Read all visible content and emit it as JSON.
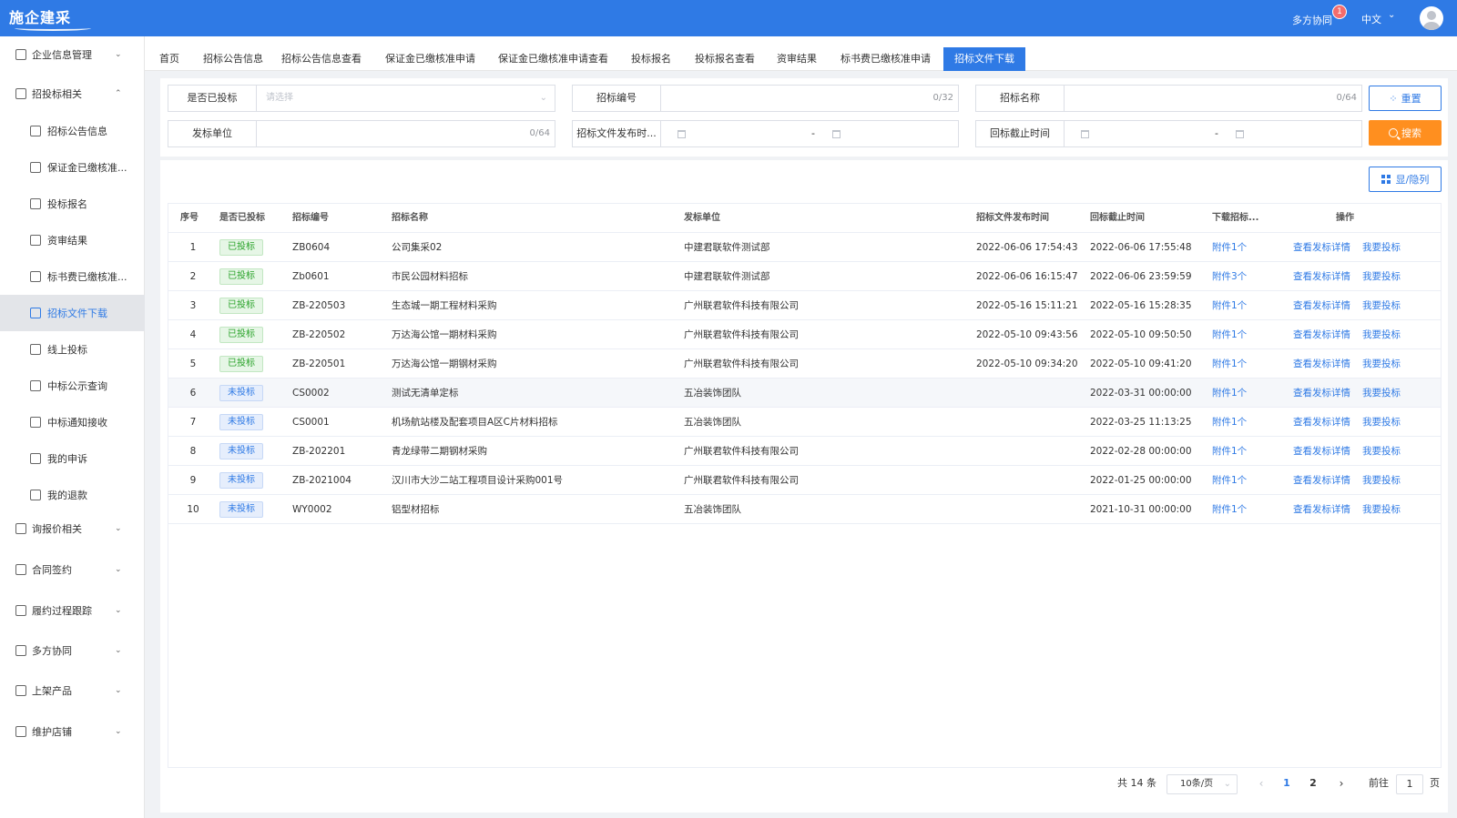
{
  "header": {
    "logo_text": "施企建采",
    "collab_label": "多方协同",
    "badge_count": "1",
    "language": "中文"
  },
  "sidebar": {
    "items": [
      {
        "label": "企业信息管理",
        "icon": "building-icon",
        "chevron": "⌄"
      },
      {
        "label": "招投标相关",
        "icon": "target-icon",
        "chevron": "⌃"
      },
      {
        "label": "招标公告信息",
        "icon": "doc-icon"
      },
      {
        "label": "保证金已缴核准...",
        "icon": "clipboard-icon"
      },
      {
        "label": "投标报名",
        "icon": "user-icon"
      },
      {
        "label": "资审结果",
        "icon": "check-doc-icon"
      },
      {
        "label": "标书费已缴核准...",
        "icon": "doc-icon"
      },
      {
        "label": "招标文件下载",
        "icon": "download-icon"
      },
      {
        "label": "线上投标",
        "icon": "doc-icon"
      },
      {
        "label": "中标公示查询",
        "icon": "list-icon"
      },
      {
        "label": "中标通知接收",
        "icon": "user-bell-icon"
      },
      {
        "label": "我的申诉",
        "icon": "user-icon"
      },
      {
        "label": "我的退款",
        "icon": "refund-icon"
      },
      {
        "label": "询报价相关",
        "icon": "quote-icon",
        "chevron": "⌄"
      },
      {
        "label": "合同签约",
        "icon": "contract-icon",
        "chevron": "⌄"
      },
      {
        "label": "履约过程跟踪",
        "icon": "user-track-icon",
        "chevron": "⌄"
      },
      {
        "label": "多方协同",
        "icon": "eye-icon",
        "chevron": "⌄"
      },
      {
        "label": "上架产品",
        "icon": "eye-icon",
        "chevron": "⌄"
      },
      {
        "label": "维护店铺",
        "icon": "user-icon",
        "chevron": "⌄"
      }
    ]
  },
  "tabs": [
    "首页",
    "招标公告信息",
    "招标公告信息查看",
    "保证金已缴核准申请",
    "保证金已缴核准申请查看",
    "投标报名",
    "投标报名查看",
    "资审结果",
    "标书费已缴核准申请",
    "招标文件下载"
  ],
  "filters": {
    "is_bid_label": "是否已投标",
    "is_bid_placeholder": "请选择",
    "bid_no_label": "招标编号",
    "bid_no_count": "0/32",
    "bid_name_label": "招标名称",
    "bid_name_count": "0/64",
    "issuer_label": "发标单位",
    "issuer_count": "0/64",
    "publish_time_label": "招标文件发布时...",
    "deadline_label": "回标截止时间",
    "date_sep": "-",
    "reset_label": "重置",
    "search_label": "搜索"
  },
  "toolbar": {
    "columns_label": "显/隐列"
  },
  "table": {
    "headers": [
      "序号",
      "是否已投标",
      "招标编号",
      "招标名称",
      "发标单位",
      "招标文件发布时间",
      "回标截止时间",
      "下载招标...",
      "操作"
    ],
    "rows": [
      {
        "no": "1",
        "status": "已投标",
        "status_type": "yes",
        "code": "ZB0604",
        "name": "公司集采02",
        "issuer": "中建君联软件测试部",
        "publish": "2022-06-06 17:54:43",
        "deadline": "2022-06-06 17:55:48",
        "attach": "附件1个",
        "op1": "查看发标详情",
        "op2": "我要投标"
      },
      {
        "no": "2",
        "status": "已投标",
        "status_type": "yes",
        "code": "Zb0601",
        "name": "市民公园材料招标",
        "issuer": "中建君联软件测试部",
        "publish": "2022-06-06 16:15:47",
        "deadline": "2022-06-06 23:59:59",
        "attach": "附件3个",
        "op1": "查看发标详情",
        "op2": "我要投标"
      },
      {
        "no": "3",
        "status": "已投标",
        "status_type": "yes",
        "code": "ZB-220503",
        "name": "生态城一期工程材料采购",
        "issuer": "广州联君软件科技有限公司",
        "publish": "2022-05-16 15:11:21",
        "deadline": "2022-05-16 15:28:35",
        "attach": "附件1个",
        "op1": "查看发标详情",
        "op2": "我要投标"
      },
      {
        "no": "4",
        "status": "已投标",
        "status_type": "yes",
        "code": "ZB-220502",
        "name": "万达海公馆一期材料采购",
        "issuer": "广州联君软件科技有限公司",
        "publish": "2022-05-10 09:43:56",
        "deadline": "2022-05-10 09:50:50",
        "attach": "附件1个",
        "op1": "查看发标详情",
        "op2": "我要投标"
      },
      {
        "no": "5",
        "status": "已投标",
        "status_type": "yes",
        "code": "ZB-220501",
        "name": "万达海公馆一期钢材采购",
        "issuer": "广州联君软件科技有限公司",
        "publish": "2022-05-10 09:34:20",
        "deadline": "2022-05-10 09:41:20",
        "attach": "附件1个",
        "op1": "查看发标详情",
        "op2": "我要投标"
      },
      {
        "no": "6",
        "status": "未投标",
        "status_type": "no",
        "code": "CS0002",
        "name": "测试无清单定标",
        "issuer": "五冶装饰团队",
        "publish": "",
        "deadline": "2022-03-31 00:00:00",
        "attach": "附件1个",
        "op1": "查看发标详情",
        "op2": "我要投标"
      },
      {
        "no": "7",
        "status": "未投标",
        "status_type": "no",
        "code": "CS0001",
        "name": "机场航站楼及配套项目A区C片材料招标",
        "issuer": "五冶装饰团队",
        "publish": "",
        "deadline": "2022-03-25 11:13:25",
        "attach": "附件1个",
        "op1": "查看发标详情",
        "op2": "我要投标"
      },
      {
        "no": "8",
        "status": "未投标",
        "status_type": "no",
        "code": "ZB-202201",
        "name": "青龙绿带二期钢材采购",
        "issuer": "广州联君软件科技有限公司",
        "publish": "",
        "deadline": "2022-02-28 00:00:00",
        "attach": "附件1个",
        "op1": "查看发标详情",
        "op2": "我要投标"
      },
      {
        "no": "9",
        "status": "未投标",
        "status_type": "no",
        "code": "ZB-2021004",
        "name": "汉川市大沙二站工程项目设计采购001号",
        "issuer": "广州联君软件科技有限公司",
        "publish": "",
        "deadline": "2022-01-25 00:00:00",
        "attach": "附件1个",
        "op1": "查看发标详情",
        "op2": "我要投标"
      },
      {
        "no": "10",
        "status": "未投标",
        "status_type": "no",
        "code": "WY0002",
        "name": "铝型材招标",
        "issuer": "五冶装饰团队",
        "publish": "",
        "deadline": "2021-10-31 00:00:00",
        "attach": "附件1个",
        "op1": "查看发标详情",
        "op2": "我要投标"
      }
    ]
  },
  "pagination": {
    "total": "共 14 条",
    "page_size": "10条/页",
    "pages": [
      "1",
      "2"
    ],
    "current": "1",
    "goto_label": "前往",
    "goto_value": "1",
    "page_unit": "页"
  },
  "colors": {
    "primary": "#2f7ae5",
    "search": "#ff8f1f",
    "tag_yes": "#2aa32a",
    "tag_no": "#2f7ae5"
  }
}
